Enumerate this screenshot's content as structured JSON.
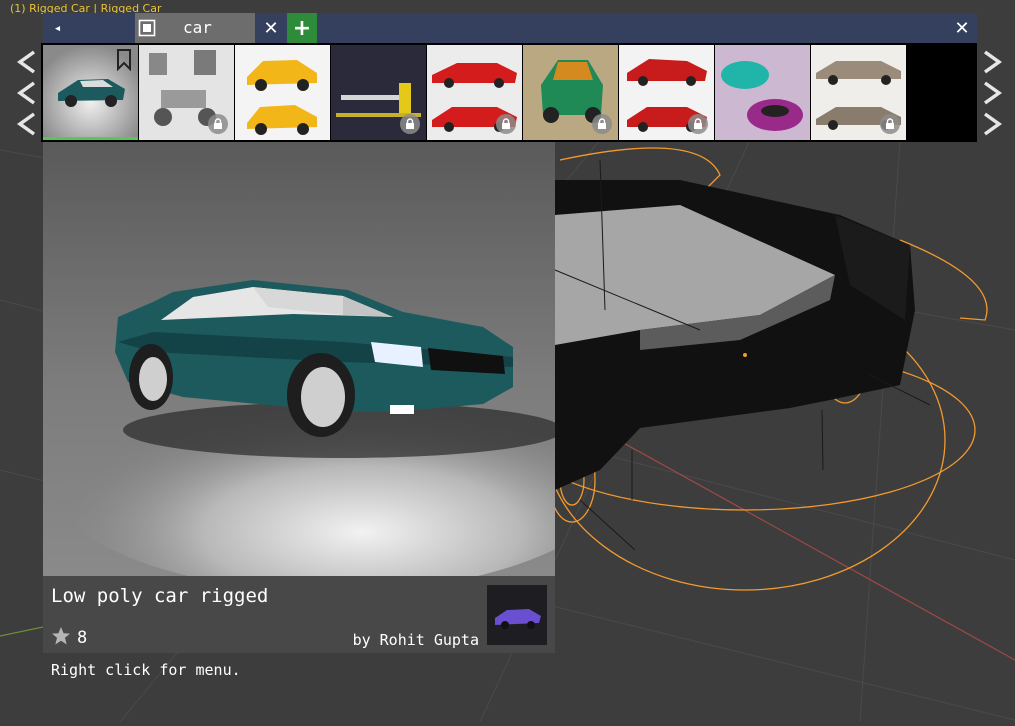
{
  "viewport": {
    "label": "(1) Rigged Car | Rigged Car"
  },
  "toolbar": {
    "back_glyph": "◂",
    "search": {
      "icon": "image-search-icon",
      "value": "car"
    },
    "clear_glyph": "✕",
    "add_glyph": "+",
    "close_glyph": "✕"
  },
  "thumbnails": [
    {
      "name": "low-poly-car-rigged",
      "selected": true,
      "bookmarked": true,
      "locked": false
    },
    {
      "name": "robot-car-parts",
      "locked": true
    },
    {
      "name": "yellow-hatchback",
      "locked": false
    },
    {
      "name": "barrier-gate",
      "locked": true
    },
    {
      "name": "red-sports-car",
      "locked": true
    },
    {
      "name": "green-mini-car",
      "locked": true
    },
    {
      "name": "red-corvette",
      "locked": true
    },
    {
      "name": "bumper-car",
      "locked": false
    },
    {
      "name": "classic-sedan",
      "locked": true
    }
  ],
  "asset": {
    "name": "Low poly car rigged",
    "rating": "8",
    "author": "by Rohit Gupta"
  },
  "hint": "Right click for menu.",
  "colors": {
    "topbar": "#34405e",
    "add_button": "#2e8b3a",
    "selection": "#57c757",
    "car_body": "#1c5a5e",
    "wireframe": "#f39a2e",
    "viewport_label": "#e8c33a"
  }
}
